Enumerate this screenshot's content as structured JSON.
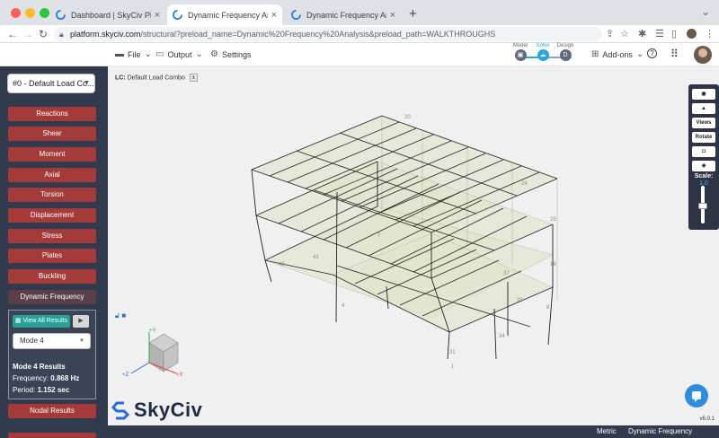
{
  "browser": {
    "tabs": [
      {
        "title": "Dashboard | SkyCiv Platform",
        "active": false
      },
      {
        "title": "Dynamic Frequency Analysis |",
        "active": true
      },
      {
        "title": "Dynamic Frequency Analysis |",
        "active": false
      }
    ],
    "url_host": "platform.skyciv.com",
    "url_path": "/structural?preload_name=Dynamic%20Frequency%20Analysis&preload_path=WALKTHROUGHS"
  },
  "header": {
    "menu": [
      {
        "label": "File",
        "icon": "file-icon"
      },
      {
        "label": "Output",
        "icon": "output-icon"
      },
      {
        "label": "Settings",
        "icon": "gear-icon"
      }
    ],
    "workflow": [
      {
        "label": "Model",
        "glyph": "▣"
      },
      {
        "label": "Solve",
        "glyph": "☁"
      },
      {
        "label": "Design",
        "glyph": "D"
      }
    ],
    "addons_label": "Add-ons",
    "colors": {
      "accent": "#2aa6df",
      "sidebar": "#323a4d",
      "button": "#a53a3a",
      "active_button": "#5b3f48",
      "teal": "#27a19a"
    }
  },
  "sidebar": {
    "load_combo": "#0 - Default Load Co...",
    "buttons": [
      "Reactions",
      "Shear",
      "Moment",
      "Axial",
      "Torsion",
      "Displacement",
      "Stress",
      "Plates",
      "Buckling",
      "Dynamic Frequency"
    ],
    "active_button": "Dynamic Frequency",
    "view_all_label": "View All Results",
    "play_icon": "play-icon",
    "mode_selected": "Mode 4",
    "result_title": "Mode 4 Results",
    "frequency_label": "Frequency:",
    "frequency_value": "0.868 Hz",
    "period_label": "Period:",
    "period_value": "1.152 sec",
    "nodal_results": "Nodal Results"
  },
  "canvas": {
    "lc_label": "LC:",
    "lc_value": "Default Load Combo",
    "lc_toggle": "±",
    "toolbox": {
      "views": "Views",
      "rotate": "Rotate",
      "scale_label": "Scale:",
      "scale_value": "1.0"
    },
    "axes": {
      "y": "+Y",
      "x": "+X",
      "z": "+Z"
    },
    "member_labels": [
      "20",
      "24",
      "25",
      "16",
      "8",
      "43",
      "37",
      "38",
      "34",
      "31",
      "4",
      "41",
      "7",
      "1"
    ],
    "logo": "SkyCiv",
    "version": "v6.0.1"
  },
  "status_bar": {
    "units": "Metric",
    "analysis": "Dynamic Frequency Analysis"
  }
}
